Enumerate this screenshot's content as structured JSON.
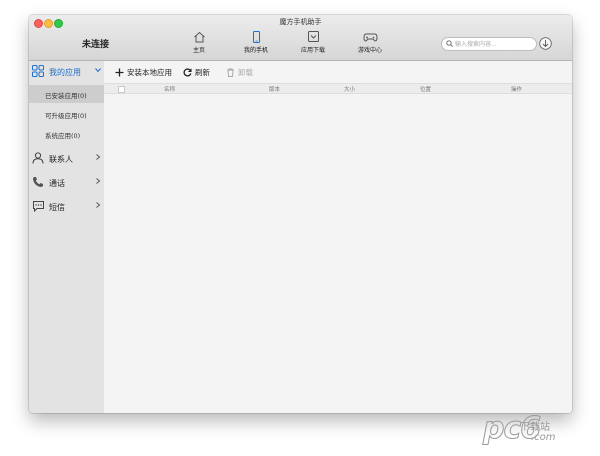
{
  "window": {
    "title": "魔方手机助手",
    "connection_status": "未连接"
  },
  "nav": {
    "tabs": [
      {
        "label": "主页",
        "icon": "home-icon",
        "active": false
      },
      {
        "label": "我的手机",
        "icon": "phone-icon",
        "active": true
      },
      {
        "label": "应用下载",
        "icon": "download-box-icon",
        "active": false
      },
      {
        "label": "游戏中心",
        "icon": "gamepad-icon",
        "active": false
      }
    ]
  },
  "search": {
    "placeholder": "输入搜索内容...",
    "value": ""
  },
  "sidebar": {
    "items": [
      {
        "label": "我的应用",
        "icon": "apps-grid-icon",
        "expanded": true
      },
      {
        "label": "联系人",
        "icon": "person-icon"
      },
      {
        "label": "通话",
        "icon": "phone-call-icon"
      },
      {
        "label": "短信",
        "icon": "message-icon"
      }
    ],
    "sub_items": [
      {
        "label": "已安装应用(0)",
        "selected": true
      },
      {
        "label": "可升级应用(0)",
        "selected": false
      },
      {
        "label": "系统应用(0)",
        "selected": false
      }
    ]
  },
  "toolbar": {
    "install_label": "安装本地应用",
    "refresh_label": "刷新",
    "uninstall_label": "卸载"
  },
  "table": {
    "columns": [
      "名称",
      "版本",
      "大小",
      "位置",
      "操作"
    ],
    "rows": []
  },
  "watermark": {
    "logo": "pc6",
    "text_top": "下载站",
    "text_bottom": ".com"
  },
  "colors": {
    "accent": "#1f6fce",
    "sidebar_bg": "#e3e3e3",
    "content_bg": "#f4f4f4"
  }
}
